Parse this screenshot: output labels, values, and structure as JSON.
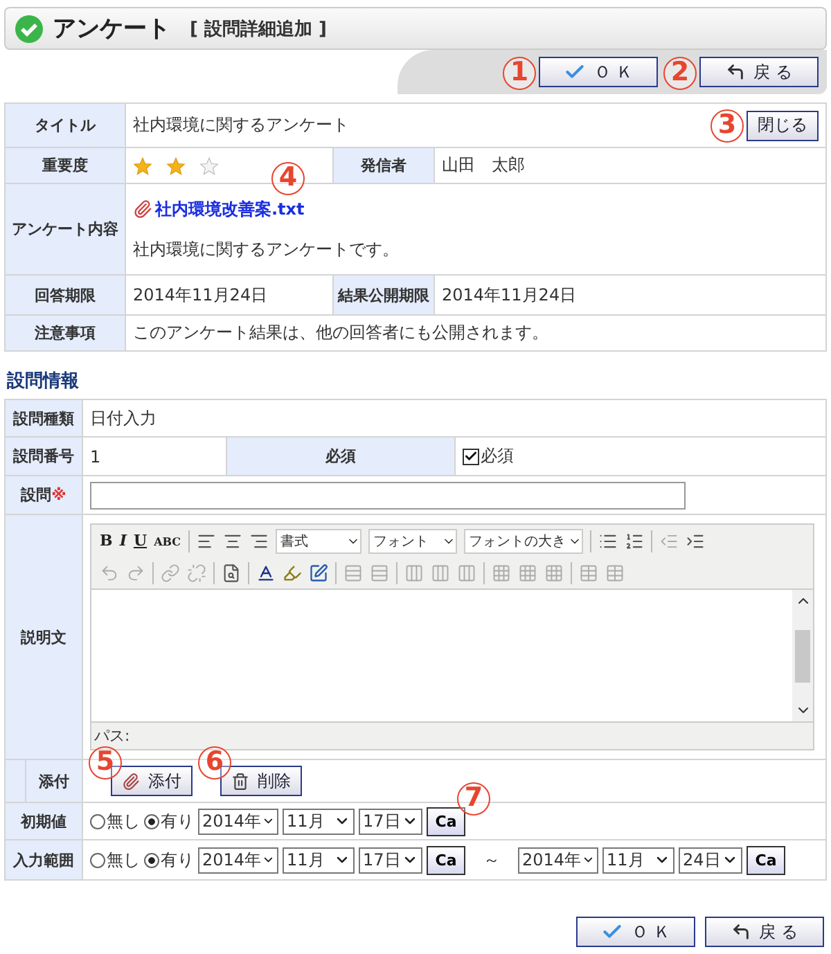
{
  "header": {
    "title": "アンケート",
    "subtitle": "[ 設問詳細追加 ]"
  },
  "top_buttons": [
    {
      "kind": "ok",
      "label": "Ｏ Ｋ",
      "callout": "1"
    },
    {
      "kind": "back",
      "label": "戻 る",
      "callout": "2"
    }
  ],
  "survey": {
    "title_label": "タイトル",
    "title": "社内環境に関するアンケート",
    "close_button": {
      "label": "閉じる",
      "callout": "3"
    },
    "importance_label": "重要度",
    "importance": {
      "stars": 2
    },
    "sender_label": "発信者",
    "sender": "山田　太郎",
    "content_label": "アンケート内容",
    "attachment": {
      "name": "社内環境改善案.txt",
      "callout": "4"
    },
    "content": "社内環境に関するアンケートです。",
    "deadline_label": "回答期限",
    "deadline": "2014年11月24日",
    "publish_label": "結果公開期限",
    "publish": "2014年11月24日",
    "notice_label": "注意事項",
    "notice": "このアンケート結果は、他の回答者にも公開されます。"
  },
  "question_section": {
    "heading": "設問情報",
    "type_label": "設問種類",
    "type": "日付入力",
    "number_label": "設問番号",
    "number": "1",
    "required_label": "必須",
    "required": {
      "label": "必須",
      "checked": true
    },
    "question_label": "設問",
    "question_mark": "※",
    "description_label": "説明文",
    "editor": {
      "toolbar_text": [
        "B",
        "I",
        "U",
        "ABC"
      ],
      "dropdowns": [
        "書式",
        "フォント",
        "フォントの大き"
      ],
      "path_label": "パス:"
    },
    "attach_label": "添付",
    "attach_buttons": [
      {
        "kind": "attach",
        "label": "添付",
        "callout": "5"
      },
      {
        "kind": "delete",
        "label": "削除",
        "callout": "6"
      }
    ],
    "initial_label": "初期値",
    "initial": {
      "options": [
        {
          "label": "無し",
          "selected": false
        },
        {
          "label": "有り",
          "selected": true
        }
      ],
      "date": [
        "2014年",
        "11月",
        "17日"
      ],
      "calendar": {
        "label": "Ca",
        "callout": "7"
      }
    },
    "range_label": "入力範囲",
    "range": {
      "options": [
        {
          "label": "無し",
          "selected": false
        },
        {
          "label": "有り",
          "selected": true
        }
      ],
      "from": [
        "2014年",
        "11月",
        "17日"
      ],
      "from_calendar": "Ca",
      "separator": "～",
      "to": [
        "2014年",
        "11月",
        "24日"
      ],
      "to_calendar": "Ca"
    }
  },
  "bottom_buttons": [
    {
      "kind": "ok",
      "label": "Ｏ Ｋ"
    },
    {
      "kind": "back",
      "label": "戻 る"
    }
  ]
}
